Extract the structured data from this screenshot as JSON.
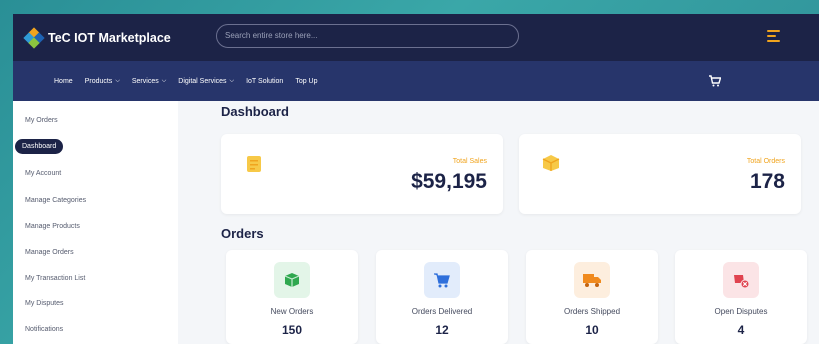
{
  "app": {
    "brand": "TeC IOT Marketplace",
    "search_placeholder": "Search entire store here..."
  },
  "nav": {
    "items": [
      {
        "label": "Home",
        "has_dropdown": false
      },
      {
        "label": "Products",
        "has_dropdown": true
      },
      {
        "label": "Services",
        "has_dropdown": true
      },
      {
        "label": "Digital Services",
        "has_dropdown": true
      },
      {
        "label": "IoT Solution",
        "has_dropdown": false
      },
      {
        "label": "Top Up",
        "has_dropdown": false
      }
    ],
    "cart_icon": "cart-icon"
  },
  "sidebar": {
    "items": [
      {
        "label": "My Orders",
        "active": false
      },
      {
        "label": "Dashboard",
        "active": true
      },
      {
        "label": "My Account",
        "active": false
      },
      {
        "label": "Manage Categories",
        "active": false
      },
      {
        "label": "Manage Products",
        "active": false
      },
      {
        "label": "Manage Orders",
        "active": false
      },
      {
        "label": "My Transaction List",
        "active": false
      },
      {
        "label": "My Disputes",
        "active": false
      },
      {
        "label": "Notifications",
        "active": false
      }
    ]
  },
  "dashboard": {
    "title": "Dashboard",
    "stats": [
      {
        "label": "Total Sales",
        "value": "$59,195",
        "icon": "document-icon"
      },
      {
        "label": "Total Orders",
        "value": "178",
        "icon": "box-icon"
      }
    ]
  },
  "orders": {
    "title": "Orders",
    "cards": [
      {
        "label": "New Orders",
        "value": "150",
        "icon": "package-icon",
        "color": "#2fa84f",
        "bg": "#e3f5e8"
      },
      {
        "label": "Orders Delivered",
        "value": "12",
        "icon": "cart-icon",
        "color": "#2f6fdb",
        "bg": "#e2ecfb"
      },
      {
        "label": "Orders Shipped",
        "value": "10",
        "icon": "truck-icon",
        "color": "#f08a1e",
        "bg": "#fdeede"
      },
      {
        "label": "Open Disputes",
        "value": "4",
        "icon": "dispute-icon",
        "color": "#e0434f",
        "bg": "#fbe4e6"
      }
    ]
  },
  "colors": {
    "navy": "#1c2347",
    "nav_blue": "#27356b",
    "accent": "#f0a41e"
  }
}
